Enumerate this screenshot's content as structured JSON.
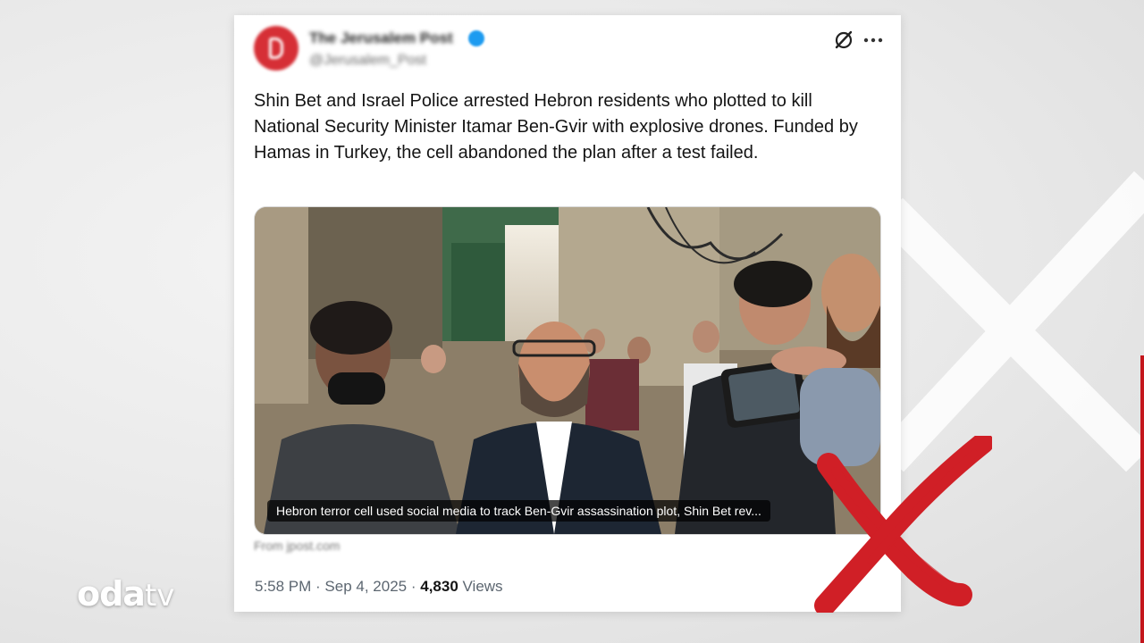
{
  "post": {
    "account_name": "The Jerusalem Post",
    "account_handle": "@Jerusalem_Post",
    "text": "Shin Bet and Israel Police arrested Hebron residents who plotted to kill National Security Minister Itamar Ben-Gvir with explosive drones. Funded by Hamas in Turkey, the cell abandoned the plan after a test failed.",
    "link_caption": "Hebron terror cell used social media to track Ben-Gvir assassination plot, Shin Bet rev...",
    "link_source": "From jpost.com",
    "time": "5:58 PM",
    "separator": " · ",
    "date": "Sep 4, 2025",
    "views_count": "4,830",
    "views_label": " Views"
  },
  "icons": {
    "grok": "grok-icon",
    "more": "more-icon",
    "verified": "verified-badge-icon"
  },
  "overlay": {
    "logo_main": "oda",
    "logo_sub": "tv"
  },
  "colors": {
    "accent_red": "#c4161c",
    "avatar_red": "#d62f36",
    "verified_blue": "#1d9bf0"
  }
}
